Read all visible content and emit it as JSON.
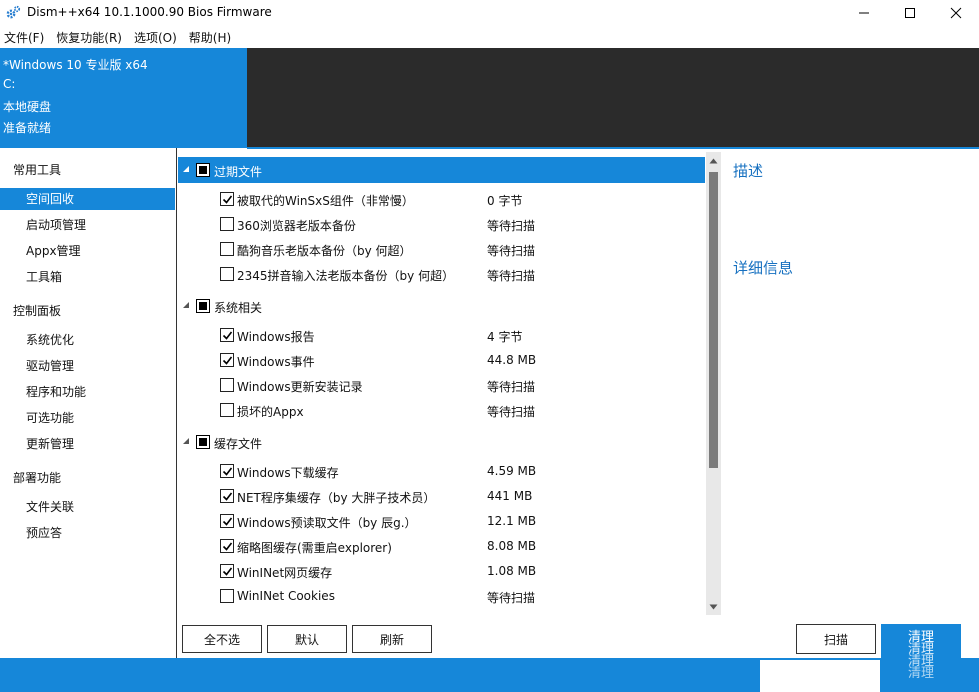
{
  "window": {
    "title": "Dism++x64 10.1.1000.90 Bios Firmware"
  },
  "menu": [
    "文件(F)",
    "恢复功能(R)",
    "选项(O)",
    "帮助(H)"
  ],
  "info": {
    "os": "*Windows 10 专业版 x64",
    "drive": "C:",
    "disk_type": "本地硬盘",
    "status": "准备就绪"
  },
  "sidebar": {
    "sections": [
      {
        "title": "常用工具",
        "items": [
          "空间回收",
          "启动项管理",
          "Appx管理",
          "工具箱"
        ]
      },
      {
        "title": "控制面板",
        "items": [
          "系统优化",
          "驱动管理",
          "程序和功能",
          "可选功能",
          "更新管理"
        ]
      },
      {
        "title": "部署功能",
        "items": [
          "文件关联",
          "预应答"
        ]
      }
    ],
    "selected": "空间回收"
  },
  "list": {
    "groups": [
      {
        "name": "过期文件",
        "items": [
          {
            "label": "被取代的WinSxS组件（非常慢）",
            "size": "0 字节",
            "checked": true
          },
          {
            "label": "360浏览器老版本备份",
            "size": "等待扫描",
            "checked": false
          },
          {
            "label": "酷狗音乐老版本备份（by 何超）",
            "size": "等待扫描",
            "checked": false
          },
          {
            "label": "2345拼音输入法老版本备份（by 何超）",
            "size": "等待扫描",
            "checked": false
          }
        ]
      },
      {
        "name": "系统相关",
        "items": [
          {
            "label": "Windows报告",
            "size": "4 字节",
            "checked": true
          },
          {
            "label": "Windows事件",
            "size": "44.8 MB",
            "checked": true
          },
          {
            "label": "Windows更新安装记录",
            "size": "等待扫描",
            "checked": false
          },
          {
            "label": "损坏的Appx",
            "size": "等待扫描",
            "checked": false
          }
        ]
      },
      {
        "name": "缓存文件",
        "items": [
          {
            "label": "Windows下载缓存",
            "size": "4.59 MB",
            "checked": true
          },
          {
            "label": "NET程序集缓存（by 大胖子技术员）",
            "size": "441 MB",
            "checked": true
          },
          {
            "label": "Windows预读取文件（by 辰g.）",
            "size": "12.1 MB",
            "checked": true
          },
          {
            "label": "缩略图缓存(需重启explorer)",
            "size": "8.08 MB",
            "checked": true
          },
          {
            "label": "WinINet网页缓存",
            "size": "1.08 MB",
            "checked": true
          },
          {
            "label": "WinINet Cookies",
            "size": "等待扫描",
            "checked": false
          }
        ]
      }
    ]
  },
  "right": {
    "description_title": "描述",
    "details_title": "详细信息"
  },
  "buttons": {
    "select_none": "全不选",
    "default": "默认",
    "refresh": "刷新",
    "scan": "扫描",
    "clean": "清理"
  },
  "colors": {
    "accent": "#1687d9",
    "dark": "#2b2b2b",
    "link": "#1670c0"
  }
}
